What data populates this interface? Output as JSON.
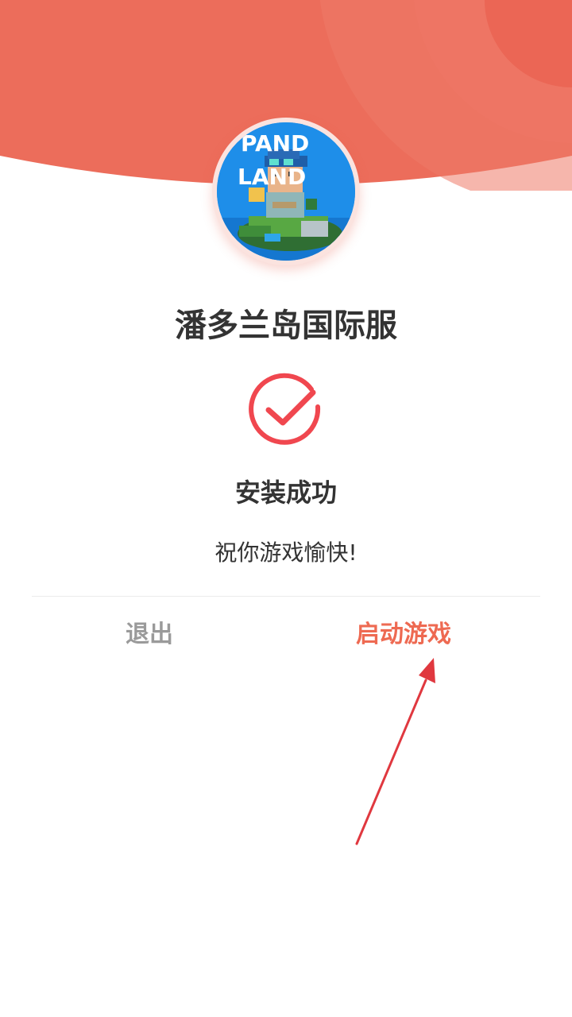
{
  "app": {
    "name": "潘多兰岛国际服",
    "icon_text_line1": "PAND",
    "icon_text_line2": "LAND"
  },
  "result": {
    "status": "安装成功",
    "message": "祝你游戏愉快!"
  },
  "actions": {
    "exit_label": "退出",
    "launch_label": "启动游戏"
  },
  "colors": {
    "header": "#ec6d5b",
    "accent": "#ee6a52",
    "check": "#f0474f",
    "exit_text": "#9a9a9a",
    "annotation_arrow": "#e0383f"
  }
}
